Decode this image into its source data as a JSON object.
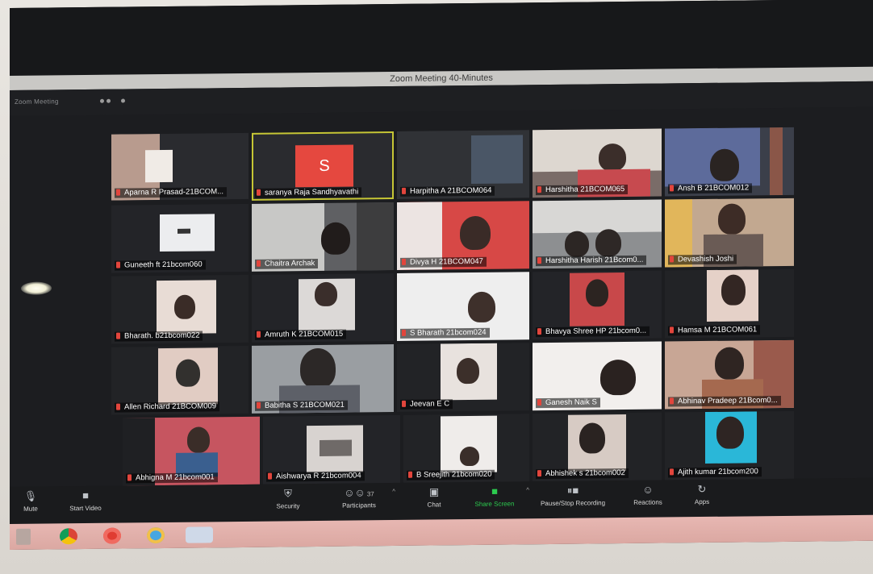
{
  "window": {
    "title": "Zoom Meeting 40-Minutes"
  },
  "meeting_info": "Zoom Meeting",
  "active_avatar_letter": "S",
  "participants": [
    "Aparna R Prasad-21BCOM...",
    "saranya Raja Sandhyavathi",
    "Harpitha A 21BCOM064",
    "Harshitha 21BCOM065",
    "Ansh B 21BCOM012",
    "Guneeth ft 21bcom060",
    "Chaitra Archak",
    "Divya H 21BCOM047",
    "Harshitha Harish 21Bcom0...",
    "Devashish Joshi",
    "Bharath. b21bcom022",
    "Amruth K 21BCOM015",
    "S Bharath 21bcom024",
    "Bhavya Shree HP 21bcom0...",
    "Hamsa M 21BCOM061",
    "Allen Richard 21BCOM009",
    "Babitha S 21BCOM021",
    "Jeevan E C",
    "Ganesh Naik S",
    "Abhinav Pradeep 21Bcom0...",
    "Abhigna M 21bcom001",
    "Aishwarya R 21bcom004",
    "B Sreejith 21bcom020",
    "Abhishek s 21bcom002",
    "Ajith kumar 21bcom200"
  ],
  "toolbar": {
    "mute": "Mute",
    "start_video": "Start Video",
    "security": "Security",
    "participants": "Participants",
    "participants_count": "37",
    "chat": "Chat",
    "share_screen": "Share Screen",
    "pause_stop_recording": "Pause/Stop Recording",
    "reactions": "Reactions",
    "apps": "Apps"
  },
  "colors": {
    "background": "#1c1d20",
    "active_speaker_border": "#c6c635",
    "avatar_bg": "#e5483f",
    "share_screen": "#2ccb4f",
    "muted_icon": "#e2453c",
    "taskbar": "#dba8a2"
  },
  "icons": [
    "microphone-icon",
    "video-icon",
    "shield-icon",
    "participants-icon",
    "chat-icon",
    "share-screen-icon",
    "record-icon",
    "reaction-icon",
    "apps-icon",
    "chrome-icon",
    "opera-icon",
    "ie-icon",
    "zoom-icon"
  ]
}
